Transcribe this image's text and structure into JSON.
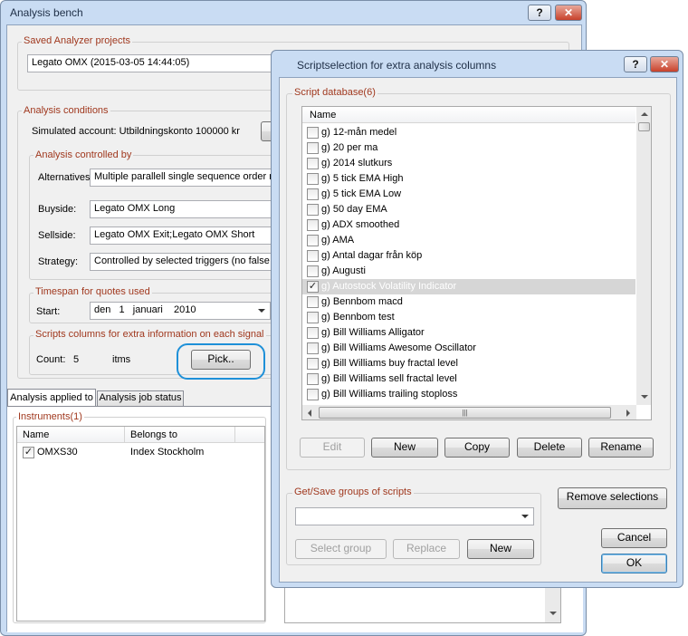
{
  "main_window": {
    "title": "Analysis bench",
    "saved_projects": {
      "legend": "Saved Analyzer projects",
      "selected": "Legato OMX  (2015-03-05 14:44:05)"
    },
    "analysis_conditions": {
      "legend": "Analysis conditions",
      "simulated_account": "Simulated account: Utbildningskonto 100000 kr",
      "controlled_by": {
        "legend": "Analysis controlled by",
        "alternatives_label": "Alternatives:",
        "alternatives_value": "Multiple parallell single sequence order mo",
        "buyside_label": "Buyside:",
        "buyside_value": "Legato OMX Long",
        "sellside_label": "Sellside:",
        "sellside_value": "Legato OMX Exit;Legato OMX Short",
        "strategy_label": "Strategy:",
        "strategy_value": "Controlled by selected triggers (no false sig"
      },
      "timespan": {
        "legend": "Timespan for quotes used",
        "start_label": "Start:",
        "start_value": "den   1   januari    2010"
      },
      "scripts_columns": {
        "legend": "Scripts columns for extra information on each signal",
        "count_label": "Count:",
        "count_value": "5",
        "count_unit": "itms",
        "pick_button": "Pick.."
      }
    },
    "tabs": [
      "Analysis applied to",
      "Analysis job status"
    ],
    "instruments": {
      "legend": "Instruments(1)",
      "columns": [
        "Name",
        "Belongs to"
      ],
      "rows": [
        {
          "checked": true,
          "name": "OMXS30",
          "belongs_to": "Index Stockholm"
        }
      ]
    }
  },
  "dialog": {
    "title": "Scriptselection for extra analysis columns",
    "script_database": {
      "legend": "Script database(6)",
      "column_header": "Name",
      "items": [
        {
          "label": "g) 12-mån medel",
          "checked": false,
          "selected": false
        },
        {
          "label": "g) 20 per ma",
          "checked": false,
          "selected": false
        },
        {
          "label": "g) 2014 slutkurs",
          "checked": false,
          "selected": false
        },
        {
          "label": "g) 5 tick EMA High",
          "checked": false,
          "selected": false
        },
        {
          "label": "g) 5 tick EMA Low",
          "checked": false,
          "selected": false
        },
        {
          "label": "g) 50 day EMA",
          "checked": false,
          "selected": false
        },
        {
          "label": "g) ADX smoothed",
          "checked": false,
          "selected": false
        },
        {
          "label": "g) AMA",
          "checked": false,
          "selected": false
        },
        {
          "label": "g) Antal dagar från köp",
          "checked": false,
          "selected": false
        },
        {
          "label": "g) Augusti",
          "checked": false,
          "selected": false
        },
        {
          "label": "g) Autostock Volatility Indicator",
          "checked": true,
          "selected": true
        },
        {
          "label": "g) Bennbom macd",
          "checked": false,
          "selected": false
        },
        {
          "label": "g) Bennbom test",
          "checked": false,
          "selected": false
        },
        {
          "label": "g) Bill Williams Alligator",
          "checked": false,
          "selected": false
        },
        {
          "label": "g) Bill Williams Awesome Oscillator",
          "checked": false,
          "selected": false
        },
        {
          "label": "g) Bill Williams buy fractal level",
          "checked": false,
          "selected": false
        },
        {
          "label": "g) Bill Williams sell fractal level",
          "checked": false,
          "selected": false
        },
        {
          "label": "g) Bill Williams trailing stoploss",
          "checked": false,
          "selected": false
        }
      ],
      "buttons": {
        "edit": "Edit",
        "new": "New",
        "copy": "Copy",
        "delete": "Delete",
        "rename": "Rename"
      }
    },
    "groups": {
      "legend": "Get/Save groups of scripts",
      "combo_value": "",
      "select_group": "Select group",
      "replace": "Replace",
      "new": "New"
    },
    "remove_selections": "Remove selections",
    "cancel": "Cancel",
    "ok": "OK"
  },
  "colors": {
    "legend_text": "#a0381e",
    "highlight_ring": "#1e90d8",
    "selected_row": "#d6d6d6"
  }
}
